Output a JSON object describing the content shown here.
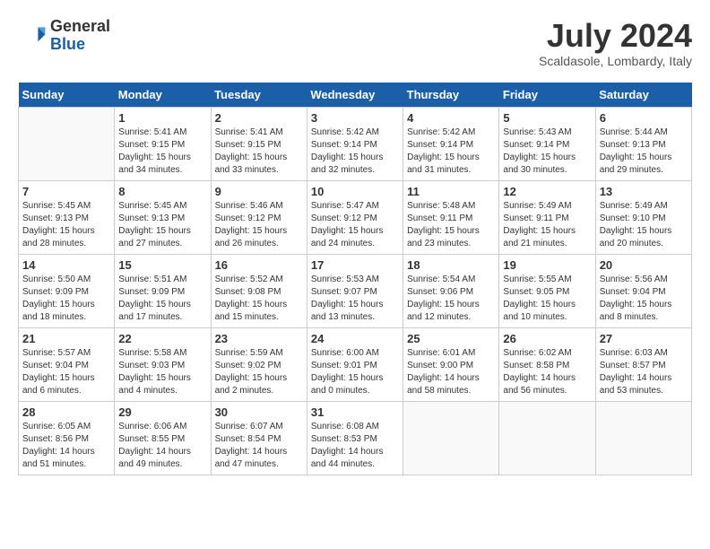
{
  "header": {
    "logo_line1": "General",
    "logo_line2": "Blue",
    "month_title": "July 2024",
    "subtitle": "Scaldasole, Lombardy, Italy"
  },
  "weekdays": [
    "Sunday",
    "Monday",
    "Tuesday",
    "Wednesday",
    "Thursday",
    "Friday",
    "Saturday"
  ],
  "weeks": [
    [
      {
        "day": "",
        "content": ""
      },
      {
        "day": "1",
        "content": "Sunrise: 5:41 AM\nSunset: 9:15 PM\nDaylight: 15 hours\nand 34 minutes."
      },
      {
        "day": "2",
        "content": "Sunrise: 5:41 AM\nSunset: 9:15 PM\nDaylight: 15 hours\nand 33 minutes."
      },
      {
        "day": "3",
        "content": "Sunrise: 5:42 AM\nSunset: 9:14 PM\nDaylight: 15 hours\nand 32 minutes."
      },
      {
        "day": "4",
        "content": "Sunrise: 5:42 AM\nSunset: 9:14 PM\nDaylight: 15 hours\nand 31 minutes."
      },
      {
        "day": "5",
        "content": "Sunrise: 5:43 AM\nSunset: 9:14 PM\nDaylight: 15 hours\nand 30 minutes."
      },
      {
        "day": "6",
        "content": "Sunrise: 5:44 AM\nSunset: 9:13 PM\nDaylight: 15 hours\nand 29 minutes."
      }
    ],
    [
      {
        "day": "7",
        "content": "Sunrise: 5:45 AM\nSunset: 9:13 PM\nDaylight: 15 hours\nand 28 minutes."
      },
      {
        "day": "8",
        "content": "Sunrise: 5:45 AM\nSunset: 9:13 PM\nDaylight: 15 hours\nand 27 minutes."
      },
      {
        "day": "9",
        "content": "Sunrise: 5:46 AM\nSunset: 9:12 PM\nDaylight: 15 hours\nand 26 minutes."
      },
      {
        "day": "10",
        "content": "Sunrise: 5:47 AM\nSunset: 9:12 PM\nDaylight: 15 hours\nand 24 minutes."
      },
      {
        "day": "11",
        "content": "Sunrise: 5:48 AM\nSunset: 9:11 PM\nDaylight: 15 hours\nand 23 minutes."
      },
      {
        "day": "12",
        "content": "Sunrise: 5:49 AM\nSunset: 9:11 PM\nDaylight: 15 hours\nand 21 minutes."
      },
      {
        "day": "13",
        "content": "Sunrise: 5:49 AM\nSunset: 9:10 PM\nDaylight: 15 hours\nand 20 minutes."
      }
    ],
    [
      {
        "day": "14",
        "content": "Sunrise: 5:50 AM\nSunset: 9:09 PM\nDaylight: 15 hours\nand 18 minutes."
      },
      {
        "day": "15",
        "content": "Sunrise: 5:51 AM\nSunset: 9:09 PM\nDaylight: 15 hours\nand 17 minutes."
      },
      {
        "day": "16",
        "content": "Sunrise: 5:52 AM\nSunset: 9:08 PM\nDaylight: 15 hours\nand 15 minutes."
      },
      {
        "day": "17",
        "content": "Sunrise: 5:53 AM\nSunset: 9:07 PM\nDaylight: 15 hours\nand 13 minutes."
      },
      {
        "day": "18",
        "content": "Sunrise: 5:54 AM\nSunset: 9:06 PM\nDaylight: 15 hours\nand 12 minutes."
      },
      {
        "day": "19",
        "content": "Sunrise: 5:55 AM\nSunset: 9:05 PM\nDaylight: 15 hours\nand 10 minutes."
      },
      {
        "day": "20",
        "content": "Sunrise: 5:56 AM\nSunset: 9:04 PM\nDaylight: 15 hours\nand 8 minutes."
      }
    ],
    [
      {
        "day": "21",
        "content": "Sunrise: 5:57 AM\nSunset: 9:04 PM\nDaylight: 15 hours\nand 6 minutes."
      },
      {
        "day": "22",
        "content": "Sunrise: 5:58 AM\nSunset: 9:03 PM\nDaylight: 15 hours\nand 4 minutes."
      },
      {
        "day": "23",
        "content": "Sunrise: 5:59 AM\nSunset: 9:02 PM\nDaylight: 15 hours\nand 2 minutes."
      },
      {
        "day": "24",
        "content": "Sunrise: 6:00 AM\nSunset: 9:01 PM\nDaylight: 15 hours\nand 0 minutes."
      },
      {
        "day": "25",
        "content": "Sunrise: 6:01 AM\nSunset: 9:00 PM\nDaylight: 14 hours\nand 58 minutes."
      },
      {
        "day": "26",
        "content": "Sunrise: 6:02 AM\nSunset: 8:58 PM\nDaylight: 14 hours\nand 56 minutes."
      },
      {
        "day": "27",
        "content": "Sunrise: 6:03 AM\nSunset: 8:57 PM\nDaylight: 14 hours\nand 53 minutes."
      }
    ],
    [
      {
        "day": "28",
        "content": "Sunrise: 6:05 AM\nSunset: 8:56 PM\nDaylight: 14 hours\nand 51 minutes."
      },
      {
        "day": "29",
        "content": "Sunrise: 6:06 AM\nSunset: 8:55 PM\nDaylight: 14 hours\nand 49 minutes."
      },
      {
        "day": "30",
        "content": "Sunrise: 6:07 AM\nSunset: 8:54 PM\nDaylight: 14 hours\nand 47 minutes."
      },
      {
        "day": "31",
        "content": "Sunrise: 6:08 AM\nSunset: 8:53 PM\nDaylight: 14 hours\nand 44 minutes."
      },
      {
        "day": "",
        "content": ""
      },
      {
        "day": "",
        "content": ""
      },
      {
        "day": "",
        "content": ""
      }
    ]
  ]
}
